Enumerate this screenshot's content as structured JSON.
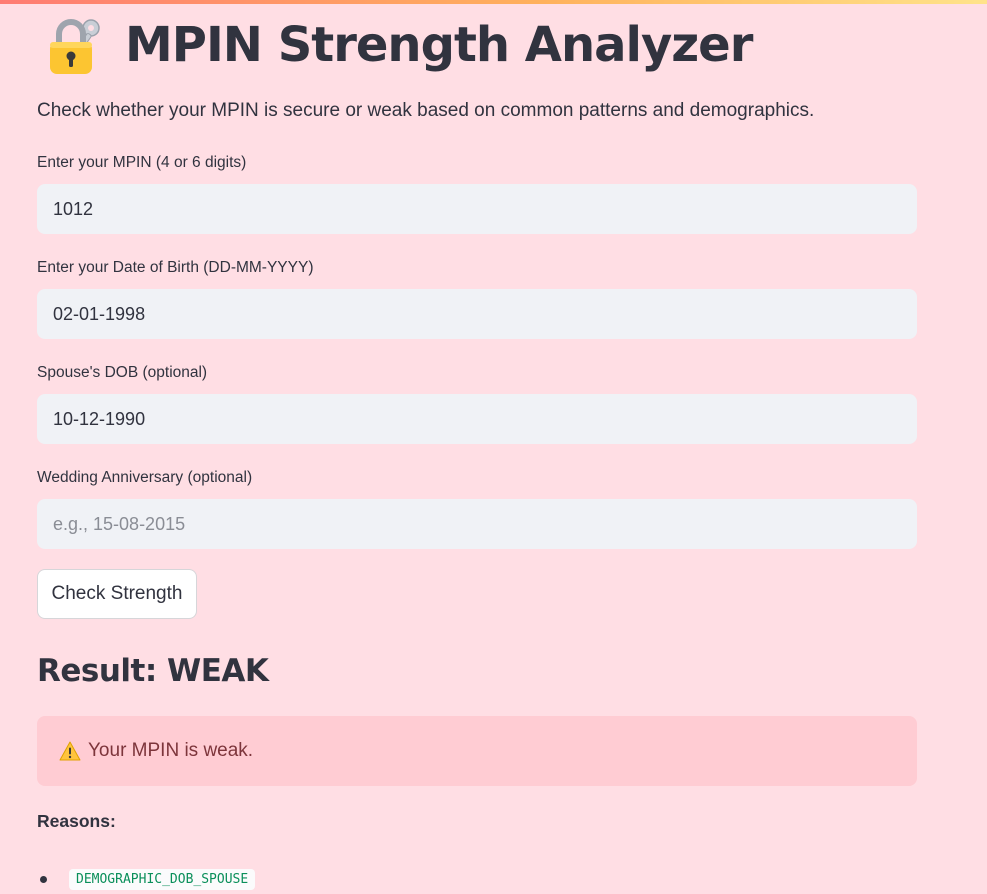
{
  "header": {
    "title": "MPIN Strength Analyzer",
    "icon": "lock-with-key-icon",
    "subtitle": "Check whether your MPIN is secure or weak based on common patterns and demographics."
  },
  "form": {
    "mpin": {
      "label": "Enter your MPIN (4 or 6 digits)",
      "value": "1012",
      "placeholder": ""
    },
    "dob": {
      "label": "Enter your Date of Birth (DD-MM-YYYY)",
      "value": "02-01-1998",
      "placeholder": ""
    },
    "spouse_dob": {
      "label": "Spouse's DOB (optional)",
      "value": "10-12-1990",
      "placeholder": ""
    },
    "anniversary": {
      "label": "Wedding Anniversary (optional)",
      "value": "",
      "placeholder": "e.g., 15-08-2015"
    },
    "submit_label": "Check Strength"
  },
  "result": {
    "heading": "Result: WEAK",
    "warning_icon": "warning-icon",
    "warning_text": "Your MPIN is weak.",
    "reasons_label": "Reasons:",
    "reasons": [
      "DEMOGRAPHIC_DOB_SPOUSE"
    ]
  },
  "colors": {
    "background": "#ffdee4",
    "input_background": "#f0f2f6",
    "warning_background": "#ffccd3",
    "warning_text": "#7d353b",
    "code_text": "#0a8f5a",
    "text": "#31333f"
  }
}
